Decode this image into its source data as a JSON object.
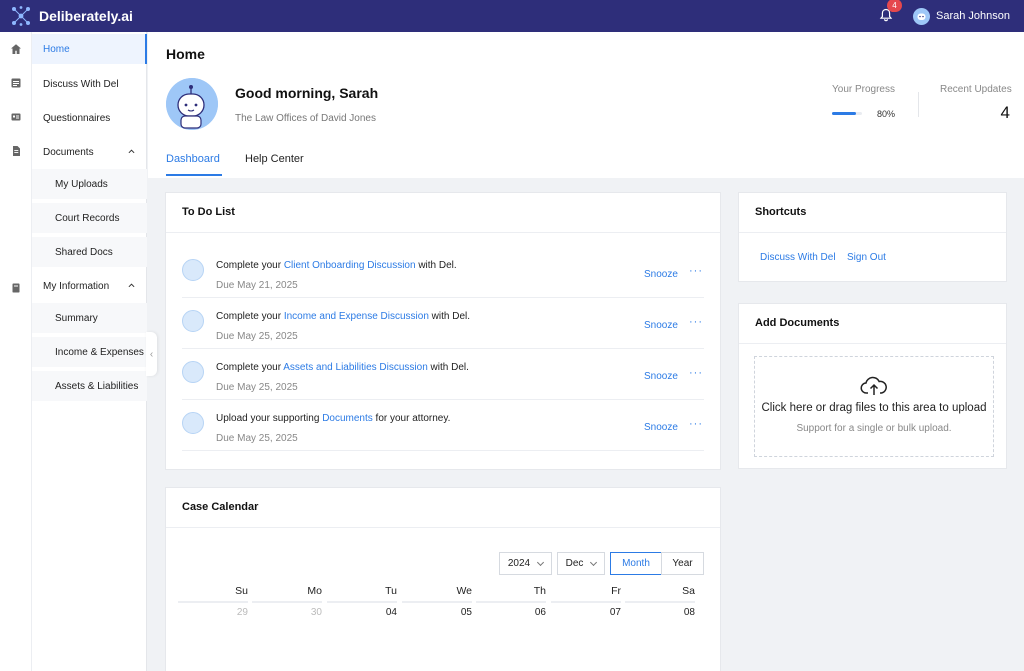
{
  "app": {
    "name": "Deliberately.ai"
  },
  "topbar": {
    "notification_count": "4",
    "user_name": "Sarah Johnson"
  },
  "sidenav": {
    "items": [
      {
        "label": "Home",
        "active": true
      },
      {
        "label": "Discuss With Del"
      },
      {
        "label": "Questionnaires"
      },
      {
        "label": "Documents"
      },
      {
        "label": "My Uploads"
      },
      {
        "label": "Court Records"
      },
      {
        "label": "Shared Docs"
      },
      {
        "label": "My Information"
      },
      {
        "label": "Summary"
      },
      {
        "label": "Income & Expenses"
      },
      {
        "label": "Assets & Liabilities"
      }
    ]
  },
  "header": {
    "title": "Home",
    "greeting": "Good morning, Sarah",
    "firm": "The Law Offices of David Jones",
    "progress_label": "Your Progress",
    "progress_value": 0.8,
    "progress_text": "80%",
    "updates_label": "Recent Updates",
    "updates_value": "4",
    "tabs": [
      {
        "label": "Dashboard",
        "active": true
      },
      {
        "label": "Help Center"
      }
    ]
  },
  "todo": {
    "title": "To Do List",
    "items": [
      {
        "pre": "Complete your ",
        "link": "Client Onboarding Discussion",
        "post": " with Del.",
        "due": "Due May 21, 2025",
        "snooze": "Snooze"
      },
      {
        "pre": "Complete your ",
        "link": "Income and Expense Discussion",
        "post": " with Del.",
        "due": "Due May 25, 2025",
        "snooze": "Snooze"
      },
      {
        "pre": "Complete your ",
        "link": "Assets and Liabilities Discussion",
        "post": " with Del.",
        "due": "Due May 25, 2025",
        "snooze": "Snooze"
      },
      {
        "pre": "Upload your supporting ",
        "link": "Documents",
        "post": " for your attorney.",
        "due": "Due May 25, 2025",
        "snooze": "Snooze"
      }
    ]
  },
  "shortcuts": {
    "title": "Shortcuts",
    "items": [
      "Discuss With Del",
      "Sign Out"
    ]
  },
  "add_documents": {
    "title": "Add Documents",
    "main": "Click here or drag files to this area to upload",
    "sub": "Support for a single or bulk upload."
  },
  "calendar": {
    "title": "Case Calendar",
    "year": "2024",
    "month": "Dec",
    "modes": [
      "Month",
      "Year"
    ],
    "selected_mode": "Month",
    "weekdays": [
      "Su",
      "Mo",
      "Tu",
      "We",
      "Th",
      "Fr",
      "Sa"
    ],
    "first_row": [
      {
        "d": "29",
        "muted": true
      },
      {
        "d": "30",
        "muted": true
      },
      {
        "d": "04"
      },
      {
        "d": "05"
      },
      {
        "d": "06"
      },
      {
        "d": "07"
      },
      {
        "d": "08"
      }
    ]
  },
  "colors": {
    "brand": "#2e2e7a",
    "accent": "#2c7be5",
    "badge": "#e5484d"
  }
}
